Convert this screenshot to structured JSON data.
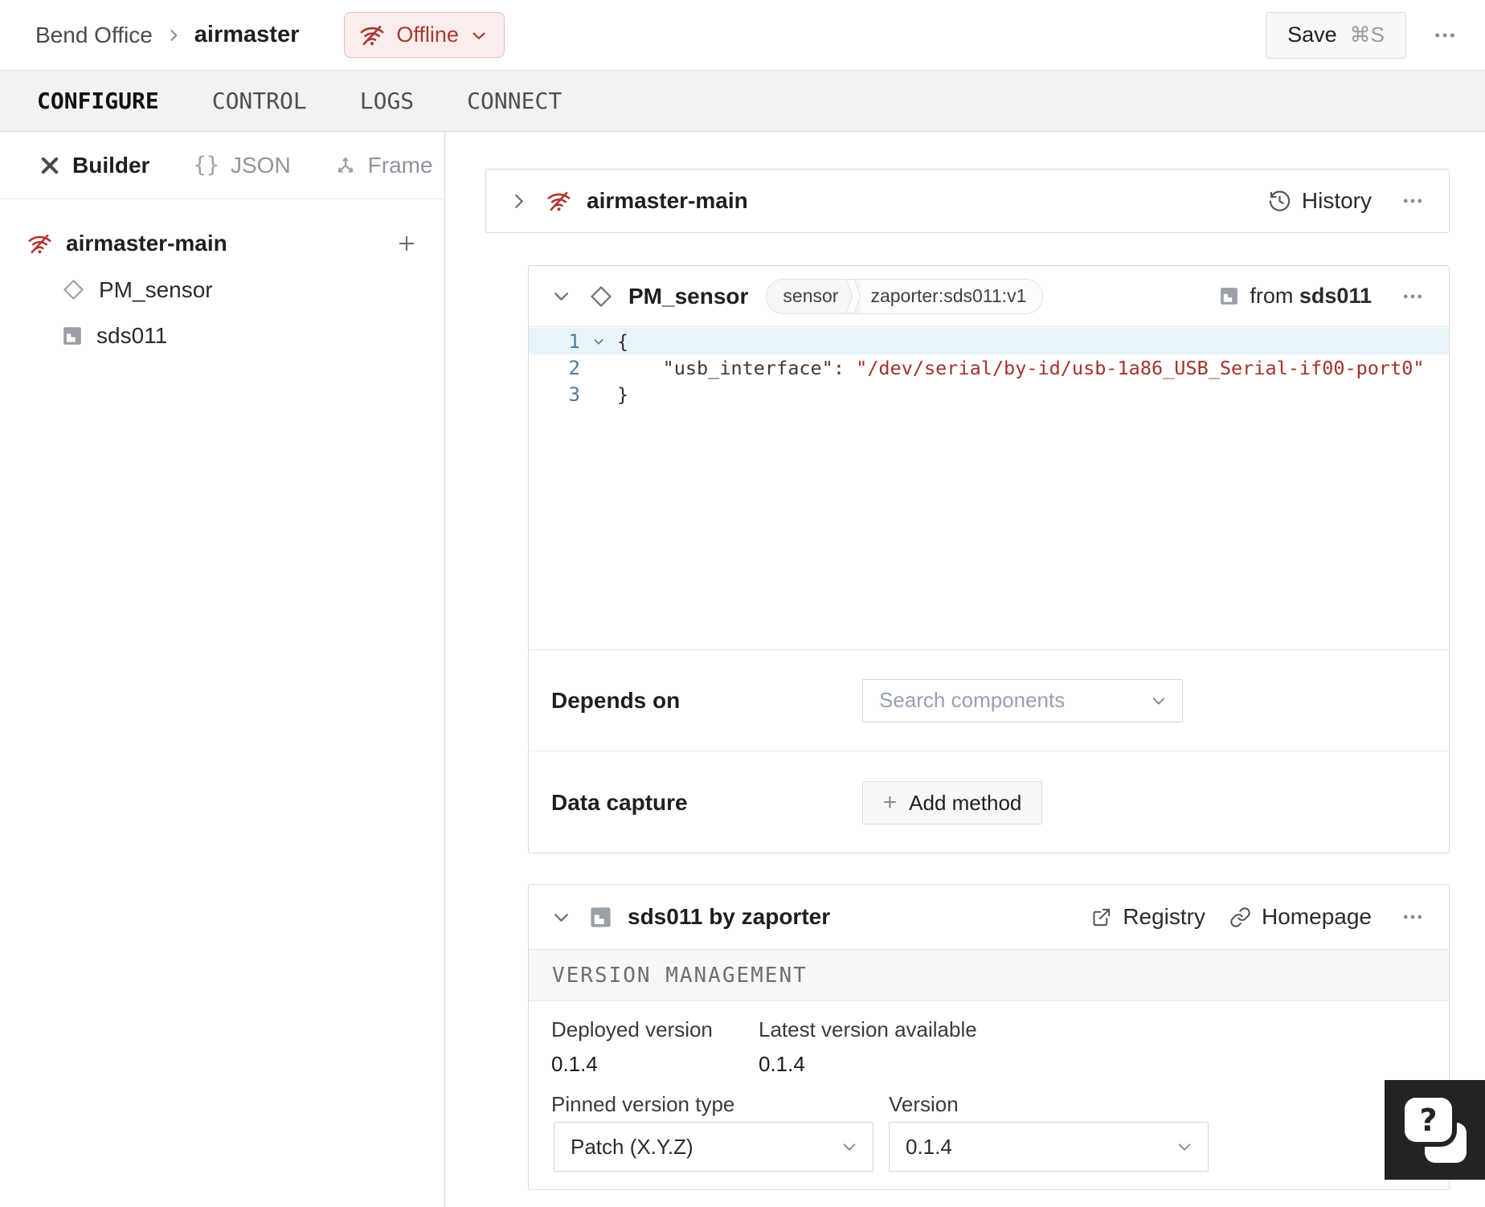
{
  "header": {
    "breadcrumb_parent": "Bend Office",
    "breadcrumb_current": "airmaster",
    "status": "Offline",
    "save_label": "Save",
    "save_shortcut": "⌘S"
  },
  "tabs": [
    {
      "label": "CONFIGURE",
      "active": true
    },
    {
      "label": "CONTROL",
      "active": false
    },
    {
      "label": "LOGS",
      "active": false
    },
    {
      "label": "CONNECT",
      "active": false
    }
  ],
  "sidebar": {
    "modes": [
      {
        "label": "Builder",
        "active": true
      },
      {
        "label": "JSON",
        "active": false
      },
      {
        "label": "Frame",
        "active": false
      }
    ],
    "json_icon_glyph": "{}",
    "tree": {
      "machine": "airmaster-main",
      "components": [
        {
          "name": "PM_sensor",
          "kind": "sensor"
        },
        {
          "name": "sds011",
          "kind": "module"
        }
      ]
    }
  },
  "main": {
    "machine_card": {
      "title": "airmaster-main",
      "history_label": "History"
    },
    "component_card": {
      "title": "PM_sensor",
      "type_badge": "sensor",
      "model_badge": "zaporter:sds011:v1",
      "from_label": "from ",
      "from_module": "sds011",
      "code": {
        "line1_num": "1",
        "line1_text": "{",
        "line2_num": "2",
        "line2_key": "    \"usb_interface\":",
        "line2_value": " \"/dev/serial/by-id/usb-1a86_USB_Serial-if00-port0\"",
        "line3_num": "3",
        "line3_text": "}"
      },
      "depends_on": {
        "label": "Depends on",
        "placeholder": "Search components"
      },
      "data_capture": {
        "label": "Data capture",
        "plus": "+",
        "add_button": "Add method"
      }
    },
    "module_card": {
      "title": "sds011 by zaporter",
      "registry_label": "Registry",
      "homepage_label": "Homepage",
      "section_header": "VERSION MANAGEMENT",
      "deployed_label": "Deployed version",
      "deployed_value": "0.1.4",
      "latest_label": "Latest version available",
      "latest_value": "0.1.4",
      "pinned_label": "Pinned version type",
      "pinned_value": "Patch (X.Y.Z)",
      "version_label": "Version",
      "version_value": "0.1.4"
    }
  },
  "help": {
    "glyph": "?"
  },
  "colors": {
    "status_red": "#a83a33",
    "status_badge_bg": "#faedec",
    "status_badge_border": "#e5beba",
    "code_string_red": "#a5322c",
    "line_number_blue": "#4a7c99",
    "line_highlight": "#e8f4fa"
  }
}
